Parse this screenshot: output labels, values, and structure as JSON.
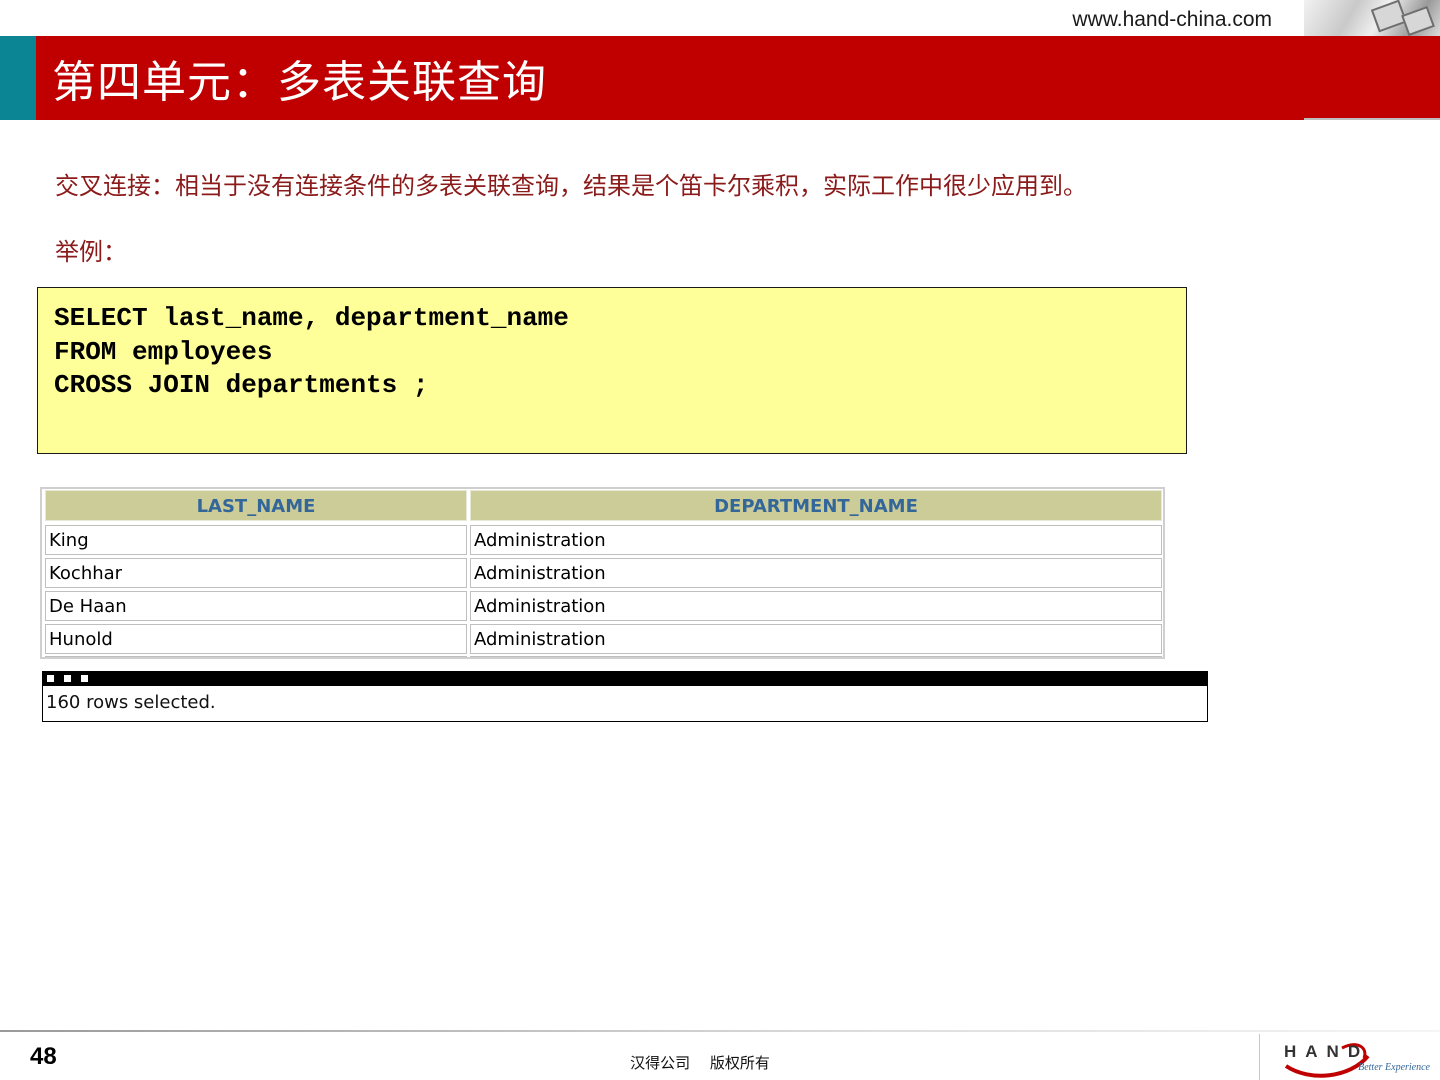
{
  "header": {
    "url": "www.hand-china.com",
    "title": "第四单元：多表关联查询"
  },
  "content": {
    "description": "交叉连接：相当于没有连接条件的多表关联查询，结果是个笛卡尔乘积，实际工作中很少应用到。",
    "example_label": "举例：",
    "code_lines": [
      "SELECT last_name, department_name",
      "FROM employees",
      "CROSS JOIN departments ;"
    ]
  },
  "result": {
    "columns": [
      "LAST_NAME",
      "DEPARTMENT_NAME"
    ],
    "rows": [
      [
        "King",
        "Administration"
      ],
      [
        "Kochhar",
        "Administration"
      ],
      [
        "De Haan",
        "Administration"
      ],
      [
        "Hunold",
        "Administration"
      ]
    ],
    "status": "160 rows selected."
  },
  "footer": {
    "page_number": "48",
    "copyright": "汉得公司　 版权所有",
    "logo_text": "HAND",
    "logo_tagline": "Better Experience"
  },
  "colors": {
    "title_bar": "#c00000",
    "title_accent": "#0b8593",
    "code_bg": "#ffff99",
    "table_header_bg": "#cccc99",
    "table_header_text": "#336699",
    "desc_text": "#8b1a1a"
  }
}
